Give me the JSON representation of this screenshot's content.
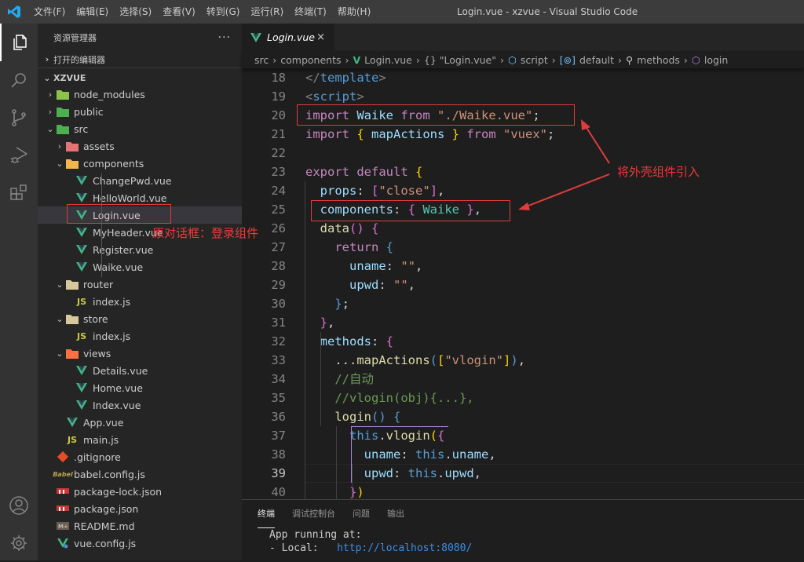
{
  "titlebar": {
    "menu": [
      "文件(F)",
      "编辑(E)",
      "选择(S)",
      "查看(V)",
      "转到(G)",
      "运行(R)",
      "终端(T)",
      "帮助(H)"
    ],
    "window_title": "Login.vue - xzvue - Visual Studio Code"
  },
  "activity_bar": {
    "items": [
      "explorer",
      "search",
      "source-control",
      "run-debug",
      "extensions"
    ],
    "bottom": [
      "accounts",
      "manage"
    ]
  },
  "sidebar": {
    "title": "资源管理器",
    "more": "···",
    "open_editors": "打开的编辑器",
    "project": "XZVUE",
    "tree": [
      {
        "name": "node_modules",
        "type": "folder",
        "depth": 1,
        "expanded": false
      },
      {
        "name": "public",
        "type": "folder",
        "depth": 1,
        "expanded": false
      },
      {
        "name": "src",
        "type": "folder",
        "depth": 1,
        "expanded": true
      },
      {
        "name": "assets",
        "type": "folder",
        "depth": 2,
        "expanded": false
      },
      {
        "name": "components",
        "type": "folder",
        "depth": 2,
        "expanded": true
      },
      {
        "name": "ChangePwd.vue",
        "type": "vue",
        "depth": 3
      },
      {
        "name": "HelloWorld.vue",
        "type": "vue",
        "depth": 3
      },
      {
        "name": "Login.vue",
        "type": "vue",
        "depth": 3,
        "selected": true
      },
      {
        "name": "MyHeader.vue",
        "type": "vue",
        "depth": 3
      },
      {
        "name": "Register.vue",
        "type": "vue",
        "depth": 3
      },
      {
        "name": "Waike.vue",
        "type": "vue",
        "depth": 3
      },
      {
        "name": "router",
        "type": "folder",
        "depth": 2,
        "expanded": true
      },
      {
        "name": "index.js",
        "type": "js",
        "depth": 3
      },
      {
        "name": "store",
        "type": "folder",
        "depth": 2,
        "expanded": true
      },
      {
        "name": "index.js",
        "type": "js",
        "depth": 3
      },
      {
        "name": "views",
        "type": "folder",
        "depth": 2,
        "expanded": true
      },
      {
        "name": "Details.vue",
        "type": "vue",
        "depth": 3
      },
      {
        "name": "Home.vue",
        "type": "vue",
        "depth": 3
      },
      {
        "name": "Index.vue",
        "type": "vue",
        "depth": 3
      },
      {
        "name": "App.vue",
        "type": "vue",
        "depth": 2
      },
      {
        "name": "main.js",
        "type": "js",
        "depth": 2
      },
      {
        "name": ".gitignore",
        "type": "git",
        "depth": 1
      },
      {
        "name": "babel.config.js",
        "type": "babel",
        "depth": 1
      },
      {
        "name": "package-lock.json",
        "type": "npm",
        "depth": 1
      },
      {
        "name": "package.json",
        "type": "npm",
        "depth": 1
      },
      {
        "name": "README.md",
        "type": "md",
        "depth": 1
      },
      {
        "name": "vue.config.js",
        "type": "vueconfig",
        "depth": 1
      }
    ]
  },
  "editor": {
    "tab": {
      "label": "Login.vue",
      "close": "×"
    },
    "breadcrumb": [
      "src",
      "components",
      "Login.vue",
      "{} \"Login.vue\"",
      "script",
      "default",
      "methods",
      "login"
    ],
    "current_line": 39,
    "lines": [
      {
        "n": 18,
        "tokens": [
          [
            "g",
            "</"
          ],
          [
            "b",
            "template"
          ],
          [
            "g",
            ">"
          ]
        ]
      },
      {
        "n": 19,
        "tokens": [
          [
            "g",
            "<"
          ],
          [
            "b",
            "script"
          ],
          [
            "g",
            ">"
          ]
        ]
      },
      {
        "n": 20,
        "tokens": [
          [
            "k",
            "import "
          ],
          [
            "v",
            "Waike "
          ],
          [
            "k",
            "from "
          ],
          [
            "s",
            "\"./Waike.vue\""
          ],
          [
            "w",
            ";"
          ]
        ]
      },
      {
        "n": 21,
        "tokens": [
          [
            "k",
            "import "
          ],
          [
            "y",
            "{ "
          ],
          [
            "v",
            "mapActions "
          ],
          [
            "y",
            "} "
          ],
          [
            "k",
            "from "
          ],
          [
            "s",
            "\"vuex\""
          ],
          [
            "w",
            ";"
          ]
        ]
      },
      {
        "n": 22,
        "tokens": []
      },
      {
        "n": 23,
        "tokens": [
          [
            "k",
            "export default "
          ],
          [
            "y",
            "{"
          ]
        ]
      },
      {
        "n": 24,
        "tokens": [
          [
            "w",
            "  "
          ],
          [
            "v",
            "props"
          ],
          [
            "w",
            ": "
          ],
          [
            "p",
            "["
          ],
          [
            "s",
            "\"close\""
          ],
          [
            "p",
            "]"
          ],
          [
            "w",
            ","
          ]
        ]
      },
      {
        "n": 25,
        "tokens": [
          [
            "w",
            "  "
          ],
          [
            "v",
            "components"
          ],
          [
            "w",
            ": "
          ],
          [
            "p",
            "{ "
          ],
          [
            "t",
            "Waike "
          ],
          [
            "p",
            "}"
          ],
          [
            "w",
            ","
          ]
        ]
      },
      {
        "n": 26,
        "tokens": [
          [
            "w",
            "  "
          ],
          [
            "f",
            "data"
          ],
          [
            "p",
            "() {"
          ]
        ]
      },
      {
        "n": 27,
        "tokens": [
          [
            "w",
            "    "
          ],
          [
            "k",
            "return "
          ],
          [
            "b",
            "{"
          ]
        ]
      },
      {
        "n": 28,
        "tokens": [
          [
            "w",
            "      "
          ],
          [
            "v",
            "uname"
          ],
          [
            "w",
            ": "
          ],
          [
            "s",
            "\"\""
          ],
          [
            "w",
            ","
          ]
        ]
      },
      {
        "n": 29,
        "tokens": [
          [
            "w",
            "      "
          ],
          [
            "v",
            "upwd"
          ],
          [
            "w",
            ": "
          ],
          [
            "s",
            "\"\""
          ],
          [
            "w",
            ","
          ]
        ]
      },
      {
        "n": 30,
        "tokens": [
          [
            "w",
            "    "
          ],
          [
            "b",
            "}"
          ],
          [
            "w",
            ";"
          ]
        ]
      },
      {
        "n": 31,
        "tokens": [
          [
            "w",
            "  "
          ],
          [
            "p",
            "}"
          ],
          [
            "w",
            ","
          ]
        ]
      },
      {
        "n": 32,
        "tokens": [
          [
            "w",
            "  "
          ],
          [
            "v",
            "methods"
          ],
          [
            "w",
            ": "
          ],
          [
            "p",
            "{"
          ]
        ]
      },
      {
        "n": 33,
        "tokens": [
          [
            "w",
            "    ..."
          ],
          [
            "f",
            "mapActions"
          ],
          [
            "b",
            "("
          ],
          [
            "y",
            "["
          ],
          [
            "s",
            "\"vlogin\""
          ],
          [
            "y",
            "]"
          ],
          [
            "b",
            ")"
          ],
          [
            "w",
            ","
          ]
        ]
      },
      {
        "n": 34,
        "tokens": [
          [
            "w",
            "    "
          ],
          [
            "c",
            "//自动"
          ]
        ]
      },
      {
        "n": 35,
        "tokens": [
          [
            "w",
            "    "
          ],
          [
            "c",
            "//vlogin(obj){...},"
          ]
        ]
      },
      {
        "n": 36,
        "tokens": [
          [
            "w",
            "    "
          ],
          [
            "f",
            "login"
          ],
          [
            "b",
            "() {"
          ]
        ]
      },
      {
        "n": 37,
        "tokens": [
          [
            "w",
            "      "
          ],
          [
            "b",
            "this"
          ],
          [
            "w",
            "."
          ],
          [
            "f",
            "vlogin"
          ],
          [
            "y",
            "("
          ],
          [
            "p",
            "{"
          ]
        ]
      },
      {
        "n": 38,
        "tokens": [
          [
            "w",
            "        "
          ],
          [
            "v",
            "uname"
          ],
          [
            "w",
            ": "
          ],
          [
            "b",
            "this"
          ],
          [
            "w",
            "."
          ],
          [
            "v",
            "uname"
          ],
          [
            "w",
            ","
          ]
        ]
      },
      {
        "n": 39,
        "tokens": [
          [
            "w",
            "        "
          ],
          [
            "v",
            "upwd"
          ],
          [
            "w",
            ": "
          ],
          [
            "b",
            "this"
          ],
          [
            "w",
            "."
          ],
          [
            "v",
            "upwd"
          ],
          [
            "w",
            ","
          ]
        ]
      },
      {
        "n": 40,
        "tokens": [
          [
            "w",
            "      "
          ],
          [
            "p",
            "}"
          ],
          [
            "y",
            ")"
          ]
        ]
      }
    ]
  },
  "annotations": {
    "sidebar_note": "原对话框：登录组件",
    "import_note": "将外壳组件引入"
  },
  "panel": {
    "tabs": [
      "终端",
      "调试控制台",
      "问题",
      "输出"
    ],
    "active_tab": "终端",
    "terminal": {
      "line1": "App running at:",
      "line2_label": "- Local:   ",
      "line2_url": "http://localhost:8080/"
    }
  }
}
